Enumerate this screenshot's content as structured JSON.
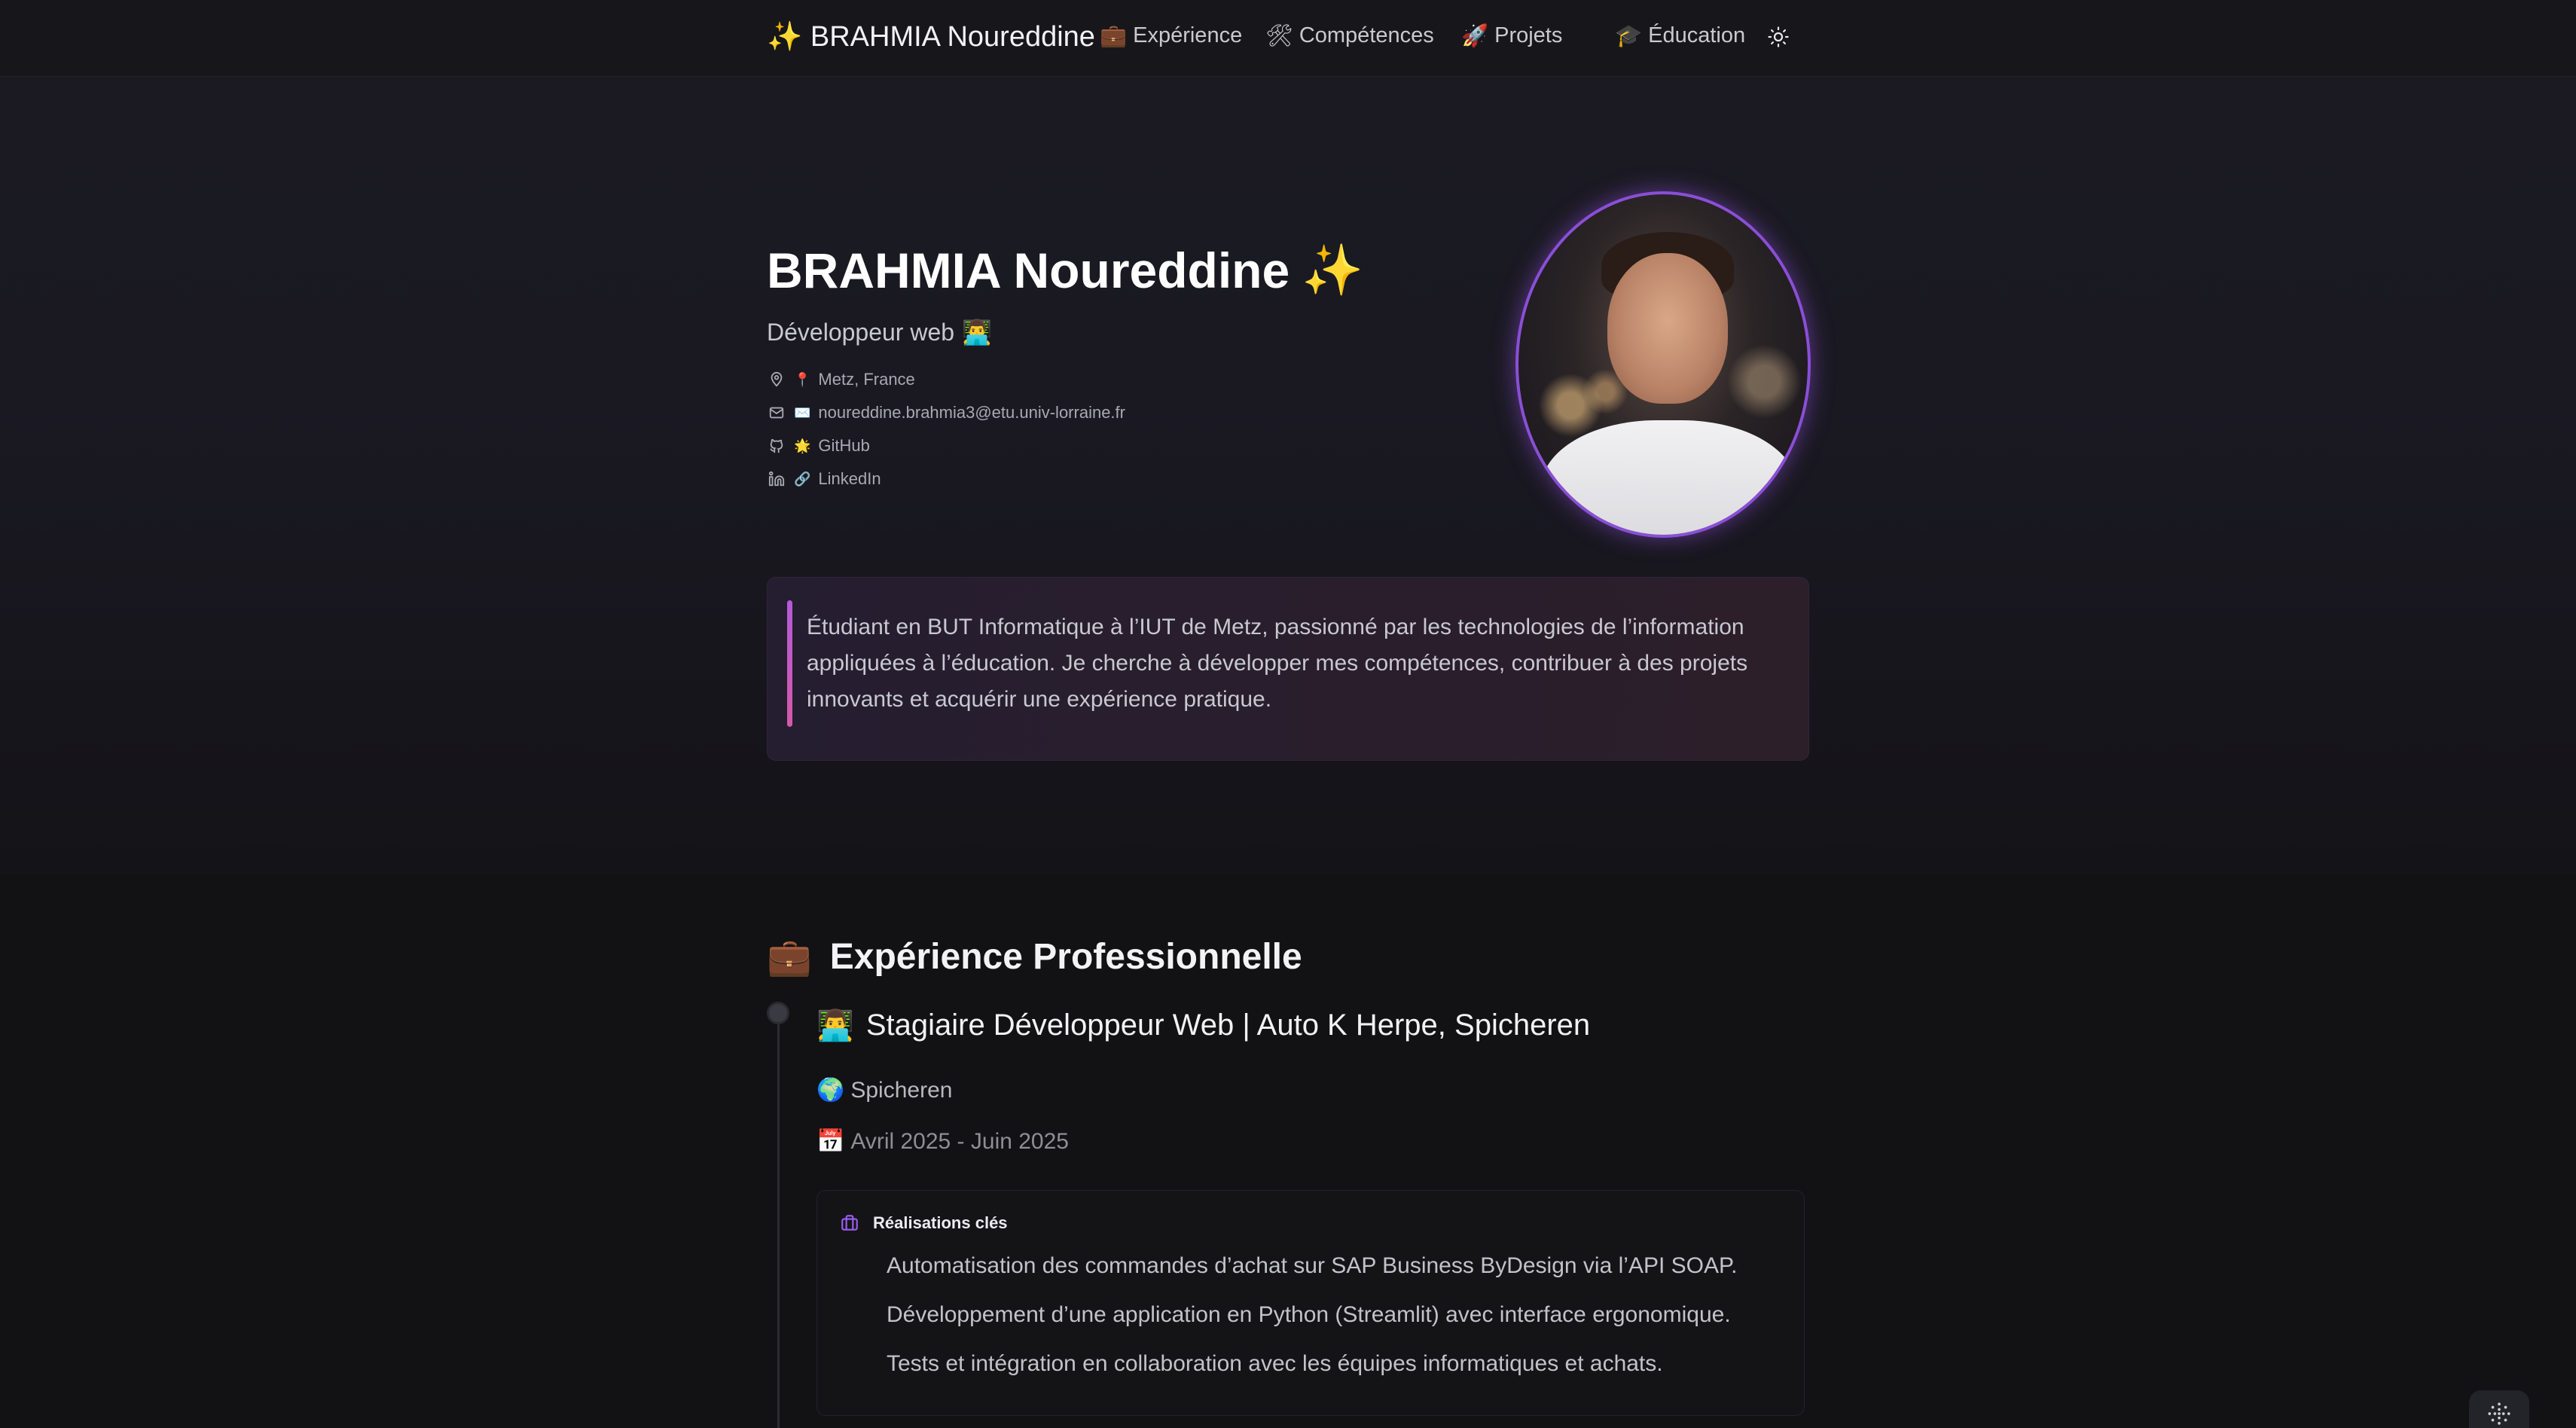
{
  "nav": {
    "brand": "✨ BRAHMIA Noureddine",
    "items": [
      {
        "icon": "💼",
        "label": "Expérience"
      },
      {
        "icon": "🛠",
        "label": "Compétences"
      },
      {
        "icon": "🚀",
        "label": "Projets"
      },
      {
        "icon": "🎓",
        "label": "Éducation"
      }
    ],
    "theme_toggle_icon": "sun-icon"
  },
  "hero": {
    "name": "BRAHMIA Noureddine",
    "name_emoji": "✨",
    "role": "Développeur web",
    "role_emoji": "👨‍💻",
    "contacts": [
      {
        "icon": "map-pin-icon",
        "emoji": "📍",
        "text": "Metz, France"
      },
      {
        "icon": "mail-icon",
        "emoji": "✉️",
        "text": "noureddine.brahmia3@etu.univ-lorraine.fr"
      },
      {
        "icon": "github-icon",
        "emoji": "🌟",
        "text": "GitHub"
      },
      {
        "icon": "linkedin-icon",
        "emoji": "🔗",
        "text": "LinkedIn"
      }
    ],
    "bio": "Étudiant en BUT Informatique à l’IUT de Metz, passionné par les technologies de l’information appliquées à l’éducation. Je cherche à développer mes compétences, contribuer à des projets innovants et acquérir une expérience pratique."
  },
  "experience": {
    "section_emoji": "💼",
    "section_title": "Expérience Professionnelle",
    "jobs": [
      {
        "emoji": "👨‍💻",
        "title": "Stagiaire Développeur Web | Auto K Herpe, Spicheren",
        "location_emoji": "🌍",
        "location": "Spicheren",
        "date_emoji": "📅",
        "dates": "Avril 2025 - Juin 2025",
        "card_title": "Réalisations clés",
        "achievements": [
          "Automatisation des commandes d’achat sur SAP Business ByDesign via l’API SOAP.",
          "Développement d’une application en Python (Streamlit) avec interface ergonomique.",
          "Tests et intégration en collaboration avec les équipes informatiques et achats."
        ]
      }
    ]
  },
  "colors": {
    "accent": "#8a4fd6",
    "bio_bar": "#c05ac0",
    "background": "#121214"
  }
}
